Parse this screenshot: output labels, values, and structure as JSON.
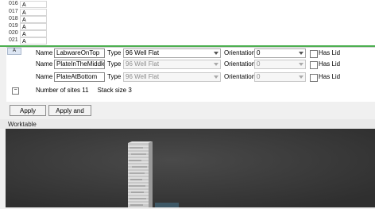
{
  "wells": [
    {
      "id": "016",
      "value": "A"
    },
    {
      "id": "017",
      "value": "A"
    },
    {
      "id": "018",
      "value": "A"
    },
    {
      "id": "019",
      "value": "A"
    },
    {
      "id": "020",
      "value": "A"
    },
    {
      "id": "021",
      "value": "A"
    }
  ],
  "side_tab": "A",
  "labware": [
    {
      "name_label": "Name",
      "name": "LabwareOnTop",
      "type_label": "Type",
      "type": "96 Well Flat",
      "orientation_label": "Orientation",
      "orientation": "0",
      "lid_label": "Has Lid"
    },
    {
      "name_label": "Name",
      "name": "PlateInTheMiddle",
      "type_label": "Type",
      "type": "96 Well Flat",
      "orientation_label": "Orientation",
      "orientation": "0",
      "lid_label": "Has Lid"
    },
    {
      "name_label": "Name",
      "name": "PlateAtBottom",
      "type_label": "Type",
      "type": "96 Well Flat",
      "orientation_label": "Orientation",
      "orientation": "0",
      "lid_label": "Has Lid"
    }
  ],
  "summary": {
    "sites": "Number of sites 11",
    "stack": "Stack size 3"
  },
  "buttons": {
    "apply": "Apply",
    "apply_close": "Apply and Close"
  },
  "collapse": "−",
  "worktable": {
    "title": "Worktable"
  },
  "colors": {
    "accent_line": "#4caf50",
    "viewport_bg": "#3b3b3b"
  }
}
